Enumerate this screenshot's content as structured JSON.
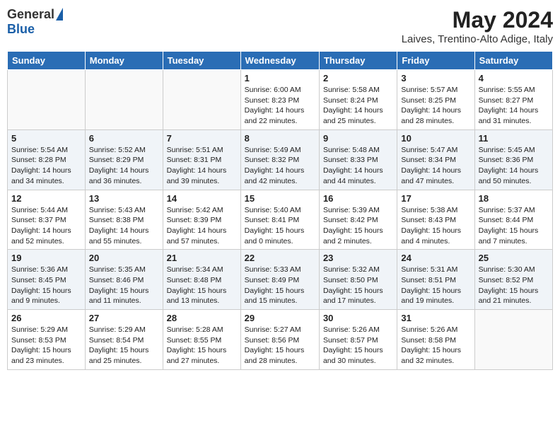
{
  "logo": {
    "general": "General",
    "blue": "Blue"
  },
  "title": "May 2024",
  "location": "Laives, Trentino-Alto Adige, Italy",
  "headers": [
    "Sunday",
    "Monday",
    "Tuesday",
    "Wednesday",
    "Thursday",
    "Friday",
    "Saturday"
  ],
  "weeks": [
    [
      {
        "day": "",
        "info": ""
      },
      {
        "day": "",
        "info": ""
      },
      {
        "day": "",
        "info": ""
      },
      {
        "day": "1",
        "info": "Sunrise: 6:00 AM\nSunset: 8:23 PM\nDaylight: 14 hours\nand 22 minutes."
      },
      {
        "day": "2",
        "info": "Sunrise: 5:58 AM\nSunset: 8:24 PM\nDaylight: 14 hours\nand 25 minutes."
      },
      {
        "day": "3",
        "info": "Sunrise: 5:57 AM\nSunset: 8:25 PM\nDaylight: 14 hours\nand 28 minutes."
      },
      {
        "day": "4",
        "info": "Sunrise: 5:55 AM\nSunset: 8:27 PM\nDaylight: 14 hours\nand 31 minutes."
      }
    ],
    [
      {
        "day": "5",
        "info": "Sunrise: 5:54 AM\nSunset: 8:28 PM\nDaylight: 14 hours\nand 34 minutes."
      },
      {
        "day": "6",
        "info": "Sunrise: 5:52 AM\nSunset: 8:29 PM\nDaylight: 14 hours\nand 36 minutes."
      },
      {
        "day": "7",
        "info": "Sunrise: 5:51 AM\nSunset: 8:31 PM\nDaylight: 14 hours\nand 39 minutes."
      },
      {
        "day": "8",
        "info": "Sunrise: 5:49 AM\nSunset: 8:32 PM\nDaylight: 14 hours\nand 42 minutes."
      },
      {
        "day": "9",
        "info": "Sunrise: 5:48 AM\nSunset: 8:33 PM\nDaylight: 14 hours\nand 44 minutes."
      },
      {
        "day": "10",
        "info": "Sunrise: 5:47 AM\nSunset: 8:34 PM\nDaylight: 14 hours\nand 47 minutes."
      },
      {
        "day": "11",
        "info": "Sunrise: 5:45 AM\nSunset: 8:36 PM\nDaylight: 14 hours\nand 50 minutes."
      }
    ],
    [
      {
        "day": "12",
        "info": "Sunrise: 5:44 AM\nSunset: 8:37 PM\nDaylight: 14 hours\nand 52 minutes."
      },
      {
        "day": "13",
        "info": "Sunrise: 5:43 AM\nSunset: 8:38 PM\nDaylight: 14 hours\nand 55 minutes."
      },
      {
        "day": "14",
        "info": "Sunrise: 5:42 AM\nSunset: 8:39 PM\nDaylight: 14 hours\nand 57 minutes."
      },
      {
        "day": "15",
        "info": "Sunrise: 5:40 AM\nSunset: 8:41 PM\nDaylight: 15 hours\nand 0 minutes."
      },
      {
        "day": "16",
        "info": "Sunrise: 5:39 AM\nSunset: 8:42 PM\nDaylight: 15 hours\nand 2 minutes."
      },
      {
        "day": "17",
        "info": "Sunrise: 5:38 AM\nSunset: 8:43 PM\nDaylight: 15 hours\nand 4 minutes."
      },
      {
        "day": "18",
        "info": "Sunrise: 5:37 AM\nSunset: 8:44 PM\nDaylight: 15 hours\nand 7 minutes."
      }
    ],
    [
      {
        "day": "19",
        "info": "Sunrise: 5:36 AM\nSunset: 8:45 PM\nDaylight: 15 hours\nand 9 minutes."
      },
      {
        "day": "20",
        "info": "Sunrise: 5:35 AM\nSunset: 8:46 PM\nDaylight: 15 hours\nand 11 minutes."
      },
      {
        "day": "21",
        "info": "Sunrise: 5:34 AM\nSunset: 8:48 PM\nDaylight: 15 hours\nand 13 minutes."
      },
      {
        "day": "22",
        "info": "Sunrise: 5:33 AM\nSunset: 8:49 PM\nDaylight: 15 hours\nand 15 minutes."
      },
      {
        "day": "23",
        "info": "Sunrise: 5:32 AM\nSunset: 8:50 PM\nDaylight: 15 hours\nand 17 minutes."
      },
      {
        "day": "24",
        "info": "Sunrise: 5:31 AM\nSunset: 8:51 PM\nDaylight: 15 hours\nand 19 minutes."
      },
      {
        "day": "25",
        "info": "Sunrise: 5:30 AM\nSunset: 8:52 PM\nDaylight: 15 hours\nand 21 minutes."
      }
    ],
    [
      {
        "day": "26",
        "info": "Sunrise: 5:29 AM\nSunset: 8:53 PM\nDaylight: 15 hours\nand 23 minutes."
      },
      {
        "day": "27",
        "info": "Sunrise: 5:29 AM\nSunset: 8:54 PM\nDaylight: 15 hours\nand 25 minutes."
      },
      {
        "day": "28",
        "info": "Sunrise: 5:28 AM\nSunset: 8:55 PM\nDaylight: 15 hours\nand 27 minutes."
      },
      {
        "day": "29",
        "info": "Sunrise: 5:27 AM\nSunset: 8:56 PM\nDaylight: 15 hours\nand 28 minutes."
      },
      {
        "day": "30",
        "info": "Sunrise: 5:26 AM\nSunset: 8:57 PM\nDaylight: 15 hours\nand 30 minutes."
      },
      {
        "day": "31",
        "info": "Sunrise: 5:26 AM\nSunset: 8:58 PM\nDaylight: 15 hours\nand 32 minutes."
      },
      {
        "day": "",
        "info": ""
      }
    ]
  ]
}
